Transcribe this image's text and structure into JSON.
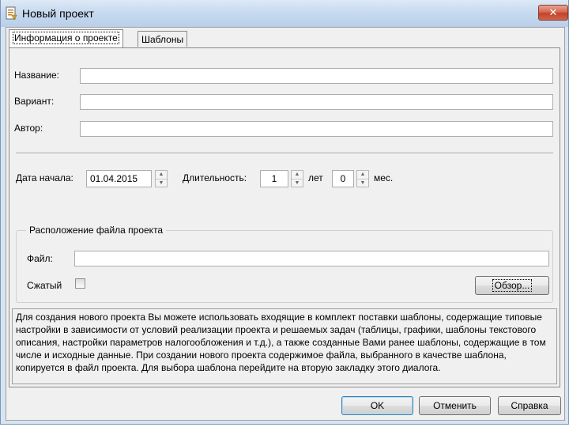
{
  "window": {
    "title": "Новый проект",
    "close_glyph": "✕"
  },
  "tabs": [
    {
      "label": "Информация о проекте",
      "active": true
    },
    {
      "label": "Шаблоны",
      "active": false
    }
  ],
  "form": {
    "name_label": "Название:",
    "name_value": "",
    "variant_label": "Вариант:",
    "variant_value": "",
    "author_label": "Автор:",
    "author_value": "",
    "start_date_label": "Дата начала:",
    "start_date_value": "01.04.2015",
    "duration_label": "Длительность:",
    "years_value": "1",
    "years_unit": "лет",
    "months_value": "0",
    "months_unit": "мес."
  },
  "file_group": {
    "title": "Расположение файла проекта",
    "file_label": "Файл:",
    "file_value": "",
    "compressed_label": "Сжатый",
    "compressed_checked": false,
    "browse_label": "Обзор..."
  },
  "info_text": "Для создания нового проекта Вы можете использовать входящие в комплект поставки шаблоны, содержащие типовые настройки в зависимости от условий реализации проекта и решаемых задач (таблицы, графики, шаблоны текстового описания, настройки параметров налогообложения и т.д.), а также созданные Вами ранее шаблоны, содержащие в том числе и исходные данные. При создании нового проекта содержимое файла, выбранного в качестве шаблона, копируется в файл проекта. Для выбора шаблона перейдите на вторую закладку этого диалога.",
  "footer": {
    "ok_label": "OK",
    "cancel_label": "Отменить",
    "help_label": "Справка"
  },
  "icons": {
    "title": "project-file-icon",
    "close": "close-icon",
    "spin_up": "spin-up-icon",
    "spin_down": "spin-down-icon"
  },
  "colors": {
    "titlebar": "#c6d9ef",
    "close_button": "#c2442a",
    "face": "#f0f0f0",
    "default_button_border": "#3c7fb1"
  }
}
